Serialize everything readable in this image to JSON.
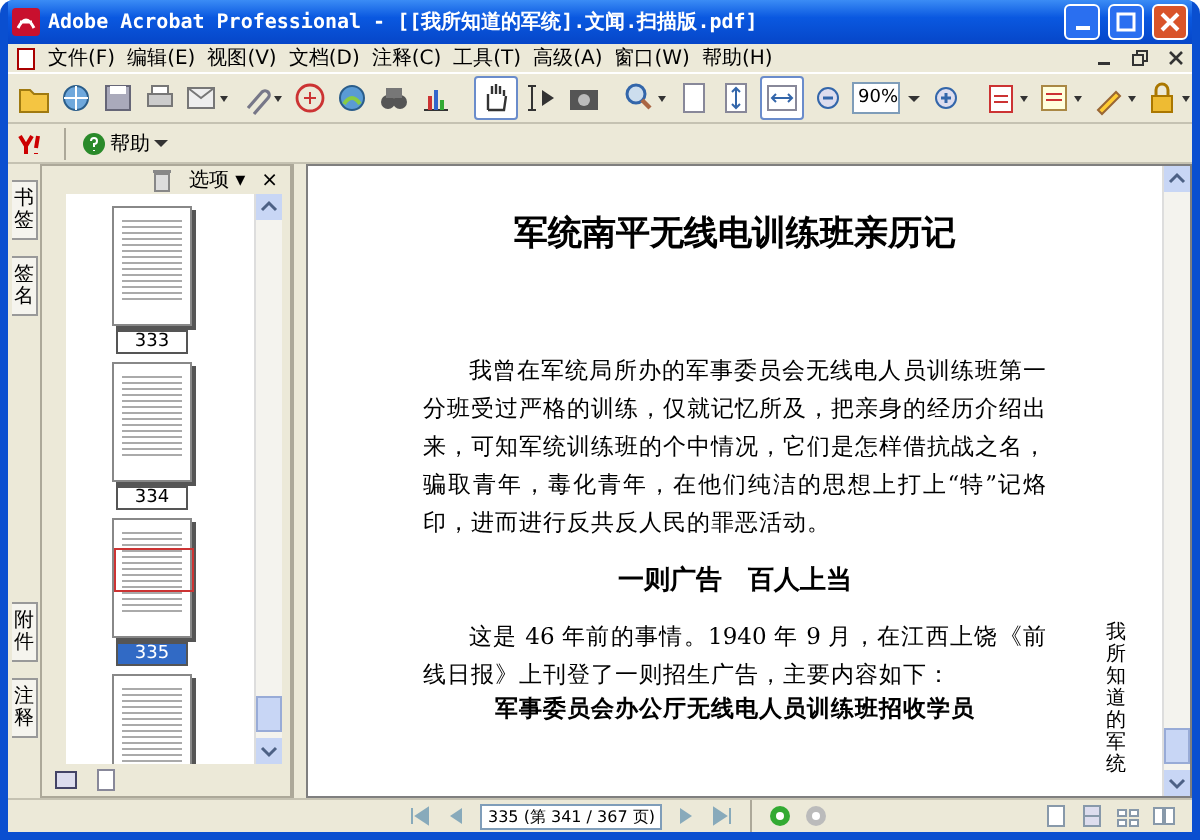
{
  "window": {
    "title": "Adobe Acrobat Professional - [[我所知道的军统].文闻.扫描版.pdf]"
  },
  "menu": [
    "文件(F)",
    "编辑(E)",
    "视图(V)",
    "文档(D)",
    "注释(C)",
    "工具(T)",
    "高级(A)",
    "窗口(W)",
    "帮助(H)"
  ],
  "toolbar": {
    "zoom": "90%"
  },
  "toolbar2": {
    "help": "帮助"
  },
  "side_tabs_top": [
    "书签",
    "签名"
  ],
  "side_tabs_bottom": [
    "附件",
    "注释"
  ],
  "panel": {
    "options": "选项 ▾",
    "close": "×"
  },
  "thumbnails": [
    {
      "label": "333",
      "selected": false
    },
    {
      "label": "334",
      "selected": false
    },
    {
      "label": "335",
      "selected": true
    },
    {
      "selected": false
    }
  ],
  "document": {
    "title": "军统南平无线电训练班亲历记",
    "paragraph1": "我曾在军统局所办的军事委员会无线电人员训练班第一分班受过严格的训练，仅就记忆所及，把亲身的经历介绍出来，可知军统训练班的个中情况，它们是怎样借抗战之名，骗取青年，毒化青年，在他们纯洁的思想上打上“特”记烙印，进而进行反共反人民的罪恶活动。",
    "subheading": "一则广告　百人上当",
    "paragraph2": "这是 46 年前的事情。1940 年 9 月，在江西上饶《前线日报》上刊登了一则招生广告，主要内容如下：",
    "notice": "军事委员会办公厅无线电人员训练班招收学员",
    "side_note": "我所知道的军统"
  },
  "status_bar": {
    "page": "335 (第 341 / 367 页)"
  }
}
